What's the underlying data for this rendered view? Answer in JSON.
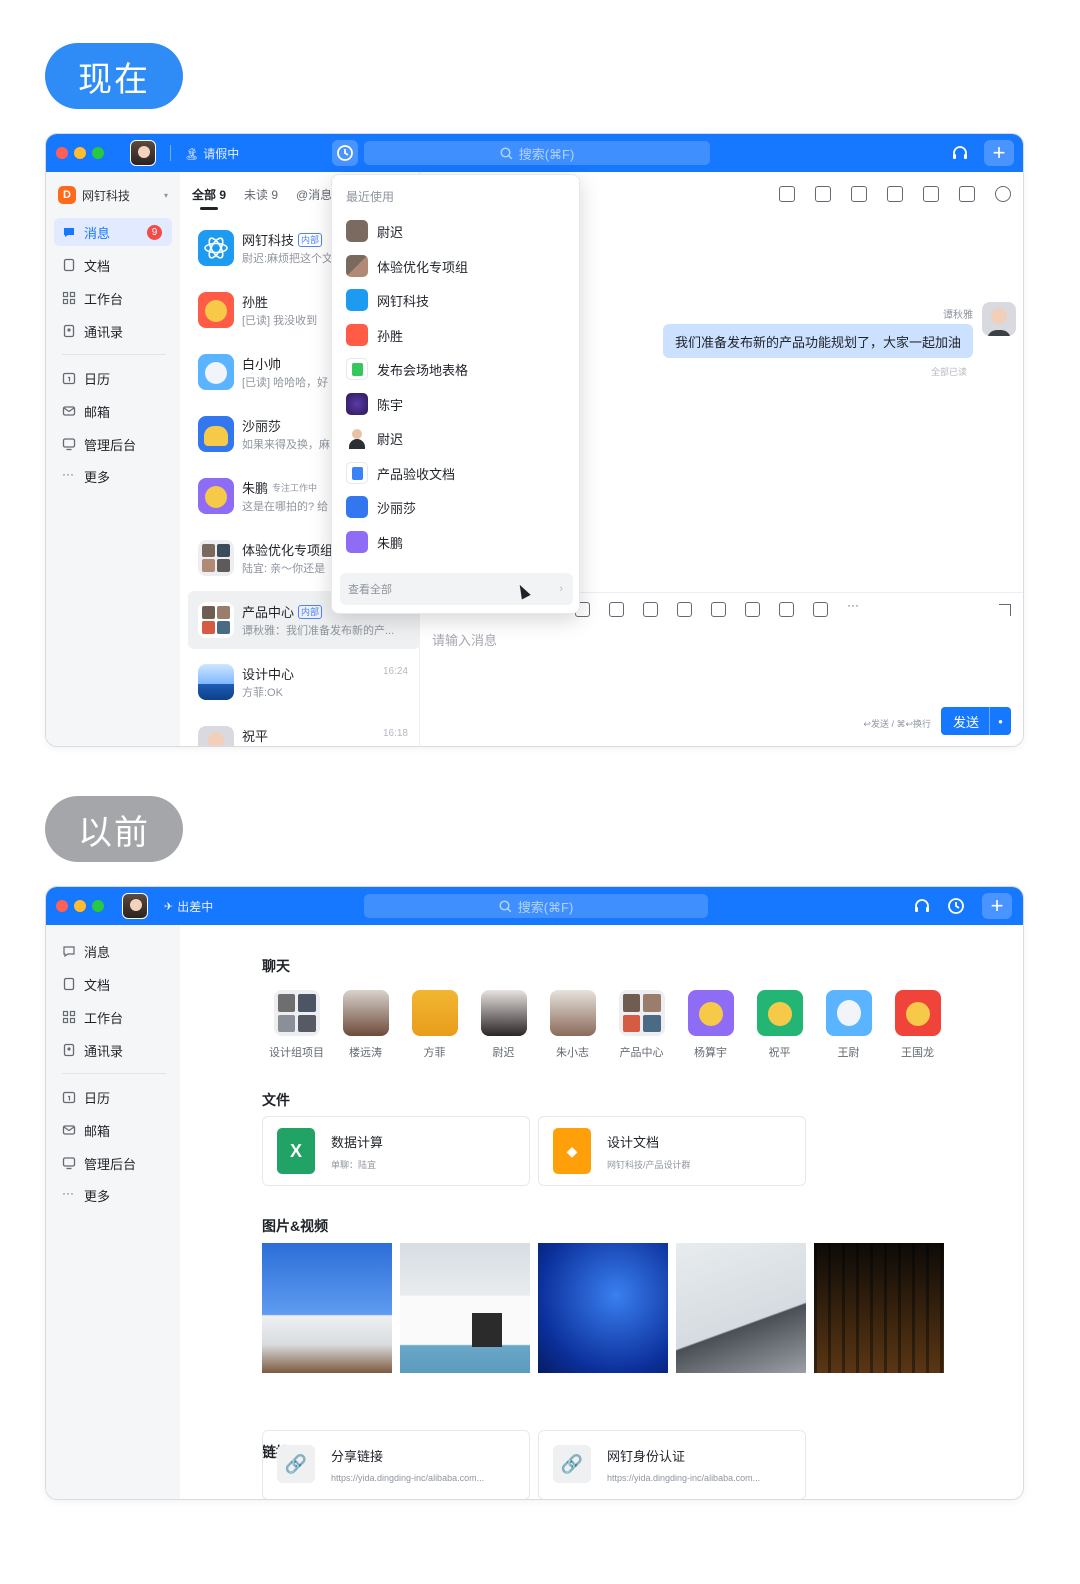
{
  "labels": {
    "now": "现在",
    "before": "以前"
  },
  "colors": {
    "accent": "#1677ff",
    "pill_now": "#2f8cf6",
    "pill_before": "#a4a6aa",
    "badge": "#f54a45"
  },
  "window_now": {
    "titlebar": {
      "status": "请假中",
      "search_placeholder": "搜索(⌘F)",
      "icons": [
        "headset-icon",
        "plus-icon",
        "history-icon"
      ]
    },
    "org": {
      "badge": "D",
      "name": "网钉科技"
    },
    "nav": [
      {
        "label": "消息",
        "icon": "message-icon",
        "badge": "9",
        "active": true
      },
      {
        "label": "文档",
        "icon": "doc-icon"
      },
      {
        "label": "工作台",
        "icon": "grid-icon"
      },
      {
        "label": "通讯录",
        "icon": "contacts-icon"
      },
      {
        "label": "日历",
        "icon": "calendar-icon"
      },
      {
        "label": "邮箱",
        "icon": "mail-icon"
      },
      {
        "label": "管理后台",
        "icon": "monitor-icon"
      },
      {
        "label": "更多",
        "icon": "more-icon"
      }
    ],
    "tabs": [
      "全部 9",
      "未读 9",
      "@消息"
    ],
    "chats": [
      {
        "name": "网钉科技",
        "tag": "内部",
        "msg": "尉迟:麻烦把这个文",
        "time": ""
      },
      {
        "name": "孙胜",
        "tag": "",
        "msg": "[已读] 我没收到",
        "time": ""
      },
      {
        "name": "白小帅",
        "tag": "",
        "msg": "[已读] 哈哈哈，好",
        "time": ""
      },
      {
        "name": "沙丽莎",
        "tag": "",
        "msg": "如果来得及换，麻",
        "time": ""
      },
      {
        "name": "朱鹏",
        "tag": "",
        "status": "专注工作中",
        "msg": "这是在哪拍的? 给",
        "time": ""
      },
      {
        "name": "体验优化专项组",
        "tag": "",
        "msg": "陆宜: 亲～你还是",
        "time": ""
      },
      {
        "name": "产品中心",
        "tag": "内部",
        "msg": "谭秋雅：我们准备发布新的产...",
        "time": ""
      },
      {
        "name": "设计中心",
        "tag": "",
        "msg": "方菲:OK",
        "time": "16:24"
      },
      {
        "name": "祝平",
        "tag": "",
        "msg": "",
        "time": "16:18"
      }
    ],
    "conversation": {
      "sender": "谭秋雅",
      "message": "我们准备发布新的产品功能规划了，大家一起加油",
      "read_status": "全部已读",
      "input_placeholder": "请输入消息",
      "send_hint": "↩发送 / ⌘↩换行",
      "send_label": "发送"
    },
    "recent_dropdown": {
      "header": "最近使用",
      "items": [
        "尉迟",
        "体验优化专项组",
        "网钉科技",
        "孙胜",
        "发布会场地表格",
        "陈宇",
        "尉迟",
        "产品验收文档",
        "沙丽莎",
        "朱鹏"
      ],
      "footer": "查看全部"
    }
  },
  "window_before": {
    "titlebar": {
      "status": "出差中",
      "search_placeholder": "搜索(⌘F)"
    },
    "nav": [
      {
        "label": "消息",
        "icon": "message-icon"
      },
      {
        "label": "文档",
        "icon": "doc-icon"
      },
      {
        "label": "工作台",
        "icon": "grid-icon"
      },
      {
        "label": "通讯录",
        "icon": "contacts-icon"
      },
      {
        "label": "日历",
        "icon": "calendar-icon"
      },
      {
        "label": "邮箱",
        "icon": "mail-icon"
      },
      {
        "label": "管理后台",
        "icon": "monitor-icon"
      },
      {
        "label": "更多",
        "icon": "more-icon"
      }
    ],
    "sections": {
      "chat": "聊天",
      "files": "文件",
      "media": "图片&视频",
      "links": "链接"
    },
    "people": [
      "设计组项目",
      "楼远涛",
      "方菲",
      "尉迟",
      "朱小志",
      "产品中心",
      "杨算宇",
      "祝平",
      "王尉",
      "王国龙"
    ],
    "files": [
      {
        "title": "数据计算",
        "sub": "单聊：陆宜",
        "icon": "excel-icon"
      },
      {
        "title": "设计文档",
        "sub": "网钉科技/产品设计群",
        "icon": "doc-orange-icon"
      }
    ],
    "links": [
      {
        "title": "分享链接",
        "url": "https://yida.dingding-inc/alibaba.com..."
      },
      {
        "title": "网钉身份认证",
        "url": "https://yida.dingding-inc/alibaba.com..."
      }
    ]
  }
}
